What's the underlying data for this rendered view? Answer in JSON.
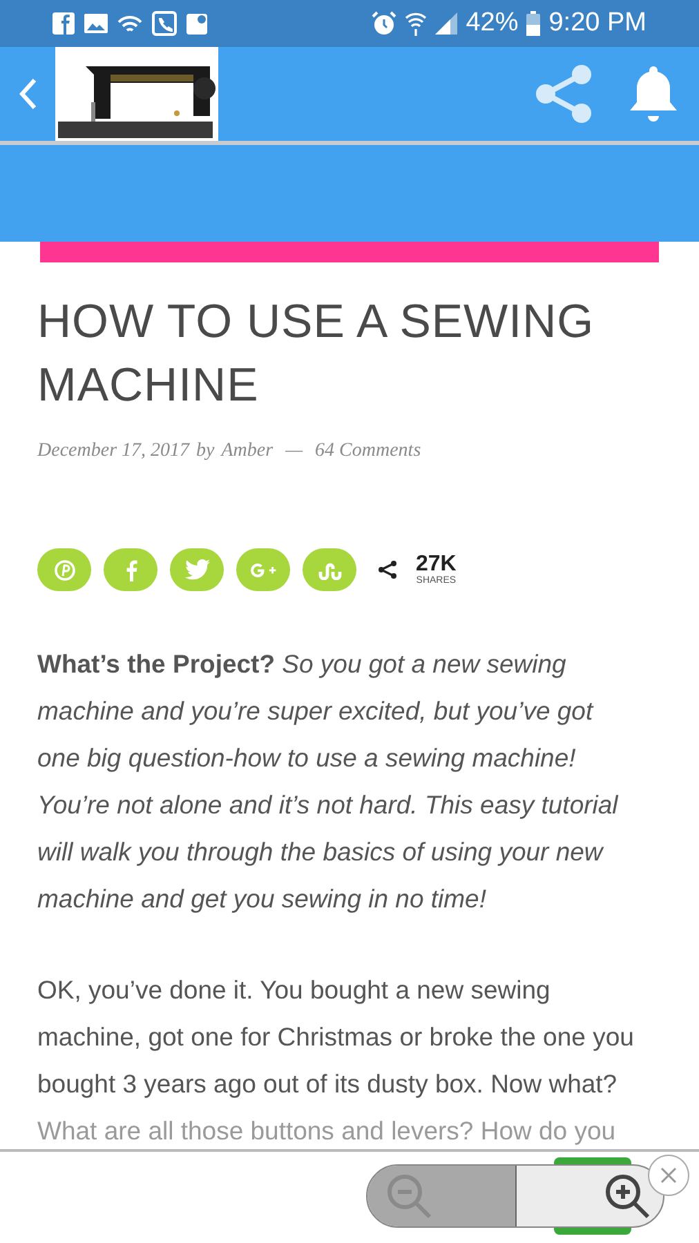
{
  "status_bar": {
    "battery": "42%",
    "time": "9:20 PM"
  },
  "article": {
    "title": "HOW TO USE A SEWING MACHINE",
    "date": "December 17, 2017",
    "by": "by",
    "author": "Amber",
    "separator": "—",
    "comments": "64 Comments"
  },
  "share": {
    "networks": [
      {
        "kind": "pinterest"
      },
      {
        "kind": "facebook"
      },
      {
        "kind": "twitter"
      },
      {
        "kind": "googleplus"
      },
      {
        "kind": "stumbleupon"
      }
    ],
    "count": "27K",
    "count_label": "SHARES"
  },
  "paragraphs": [
    "**What’s the Project?** *So you got a new sewing machine and you’re super excited, but you’ve got one big question-how to use a sewing machine! You’re not alone and it’s not hard. This easy tutorial will walk you through the basics of using your new machine and get you sewing in no time!*",
    "OK, you’ve done it. You bought a new sewing machine, got one for Christmas or broke the one you bought 3 years ago out of its dusty box. Now what?"
  ],
  "faded_line": "What are all those buttons and levers? How do you"
}
